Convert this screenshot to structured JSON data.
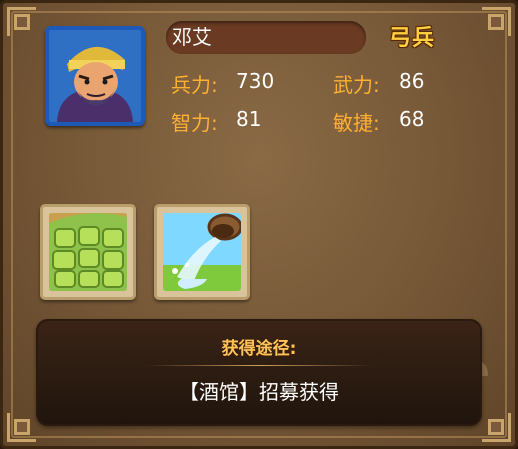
{
  "hero": {
    "name": "邓艾",
    "unit_type": "弓兵",
    "stats": {
      "power_label": "兵力:",
      "power_value": "730",
      "force_label": "武力:",
      "force_value": "86",
      "intellect_label": "智力:",
      "intellect_value": "81",
      "agility_label": "敏捷:",
      "agility_value": "68"
    }
  },
  "skills": [
    {
      "icon": "green-grid-skill-icon"
    },
    {
      "icon": "water-splash-skill-icon"
    }
  ],
  "source": {
    "title": "获得途径:",
    "text": "【酒馆】招募获得"
  },
  "colors": {
    "label": "#ffb030",
    "unit_type": "#ffcf3f",
    "portrait_frame": "#1d5ab8",
    "source_title": "#ffc35a"
  }
}
